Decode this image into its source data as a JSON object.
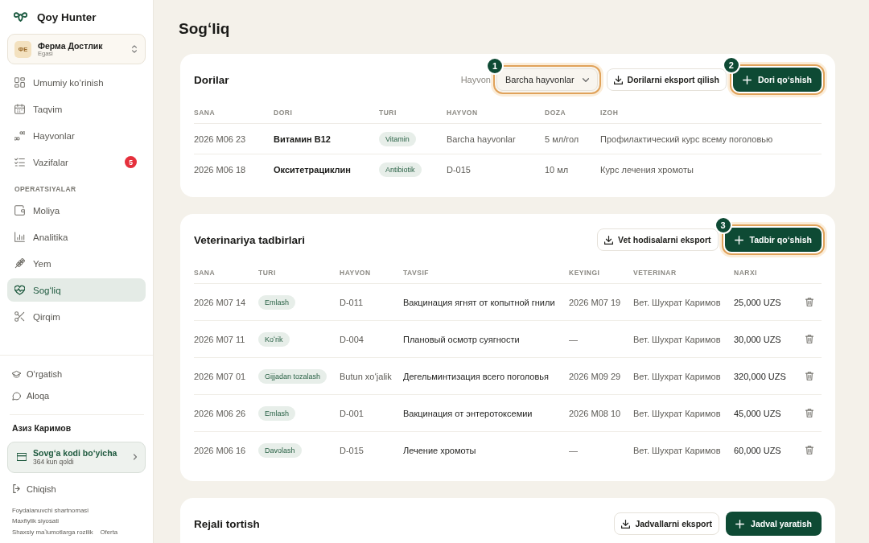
{
  "sidebar": {
    "brand": "Qoy Hunter",
    "farm": {
      "initials": "ФЕ",
      "name": "Ферма Достлик",
      "role": "Egasi"
    },
    "nav": [
      {
        "label": "Umumiy koʻrinish",
        "selected": false
      },
      {
        "label": "Taqvim",
        "selected": false
      },
      {
        "label": "Hayvonlar",
        "selected": false
      },
      {
        "label": "Vazifalar",
        "selected": false,
        "count": "5"
      }
    ],
    "operations": {
      "title": "OPERATSIYALAR",
      "items": [
        {
          "label": "Moliya",
          "selected": false
        },
        {
          "label": "Analitika",
          "selected": false
        },
        {
          "label": "Yem",
          "selected": false
        },
        {
          "label": "Sogʻliq",
          "selected": true
        },
        {
          "label": "Qirqim",
          "selected": false
        }
      ]
    },
    "help_links": [
      "Oʻrgatish",
      "Aloqa"
    ],
    "user_name": "Азиз Каримов",
    "gift_code": {
      "title": "Sovgʻa kodi boʻyicha",
      "subtitle": "364 kun qoldi"
    },
    "logout": "Chiqish",
    "legal_links": [
      [
        "Foydalanuvchi shartnomasi"
      ],
      [
        "Maxfiylik siyosati"
      ],
      [
        "Shaxsiy maʼlumotlarga rozilik",
        "Oferta"
      ]
    ]
  },
  "page_title": "Sogʻliq",
  "cards": [
    {
      "title": "Dorilar",
      "filter": {
        "label": "Hayvon",
        "value": "Barcha hayvonlar",
        "callout": "1"
      },
      "export_button": {
        "label": "Dorilarni eksport qilish"
      },
      "add_button": {
        "label": "Dori qoʻshish",
        "callout": "2"
      },
      "table": {
        "columns": [
          {
            "label": "SANA",
            "kind": "muted"
          },
          {
            "label": "DORI",
            "kind": "bold"
          },
          {
            "label": "TURI",
            "kind": "tag"
          },
          {
            "label": "HAYVON",
            "kind": "muted"
          },
          {
            "label": "DOZA",
            "kind": "muted"
          },
          {
            "label": "IZOH",
            "kind": "muted"
          }
        ],
        "rows": [
          [
            "2026 M06 23",
            "Витамин B12",
            "Vitamin",
            "Barcha hayvonlar",
            "5 мл/гол",
            "Профилактический курс всему поголовью"
          ],
          [
            "2026 M06 18",
            "Окситетрациклин",
            "Antibiotik",
            "D-015",
            "10 мл",
            "Курс лечения хромоты"
          ]
        ]
      }
    },
    {
      "title": "Veterinariya tadbirlari",
      "export_button": {
        "label": "Vet hodisalarni eksport"
      },
      "add_button": {
        "label": "Tadbir qoʻshish",
        "callout": "3"
      },
      "table": {
        "columns": [
          {
            "label": "SANA",
            "kind": "muted"
          },
          {
            "label": "TURI",
            "kind": "tag"
          },
          {
            "label": "HAYVON",
            "kind": "muted"
          },
          {
            "label": "TAVSIF",
            "kind": "dark"
          },
          {
            "label": "KEYINGI",
            "kind": "muted"
          },
          {
            "label": "VETERINAR",
            "kind": "muted"
          },
          {
            "label": "NARXI",
            "kind": "dark"
          }
        ],
        "deletable_rows": true,
        "rows": [
          [
            "2026 M07 14",
            "Emlash",
            "D-011",
            "Вакцинация ягнят от копытной гнили",
            "2026 M07 19",
            "Вет. Шухрат Каримов",
            "25,000 UZS"
          ],
          [
            "2026 M07 11",
            "Koʻrik",
            "D-004",
            "Плановый осмотр суягности",
            "—",
            "Вет. Шухрат Каримов",
            "30,000 UZS"
          ],
          [
            "2026 M07 01",
            "Gijjadan tozalash",
            "Butun xoʻjalik",
            "Дегельминтизация всего поголовья",
            "2026 M09 29",
            "Вет. Шухрат Каримов",
            "320,000 UZS"
          ],
          [
            "2026 M06 26",
            "Emlash",
            "D-001",
            "Вакцинация от энтеротоксемии",
            "2026 M08 10",
            "Вет. Шухрат Каримов",
            "45,000 UZS"
          ],
          [
            "2026 M06 16",
            "Davolash",
            "D-015",
            "Лечение хромоты",
            "—",
            "Вет. Шухрат Каримов",
            "60,000 UZS"
          ]
        ]
      }
    },
    {
      "title": "Rejali tortish",
      "export_button": {
        "label": "Jadvallarni eksport"
      },
      "add_button": {
        "label": "Jadval yaratish"
      }
    }
  ]
}
